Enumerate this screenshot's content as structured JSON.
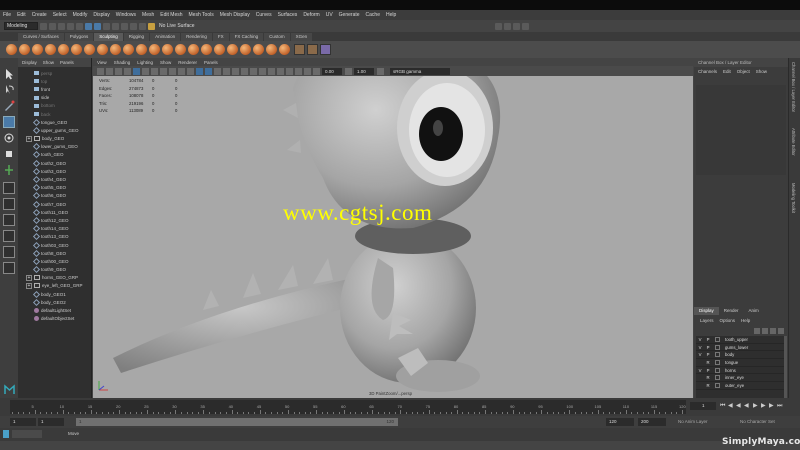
{
  "menubar": {
    "items": [
      "File",
      "Edit",
      "Create",
      "Select",
      "Modify",
      "Display",
      "Windows",
      "Mesh",
      "Edit Mesh",
      "Mesh Tools",
      "Mesh Display",
      "Curves",
      "Surfaces",
      "Deform",
      "UV",
      "Generate",
      "Cache",
      "Help"
    ]
  },
  "statusline": {
    "mode": "Modeling",
    "live_surface": "No Live Surface"
  },
  "shelf": {
    "tabs": [
      "Curves / Surfaces",
      "Polygons",
      "Sculpting",
      "Rigging",
      "Animation",
      "Rendering",
      "FX",
      "FX Caching",
      "Custom",
      "XGen"
    ],
    "active_tab": "Sculpting"
  },
  "outliner": {
    "menu": [
      "Display",
      "Show",
      "Panels"
    ],
    "items": [
      {
        "label": "persp",
        "icon": "camera-icon",
        "dim": true,
        "expand": false
      },
      {
        "label": "top",
        "icon": "camera-icon",
        "dim": true,
        "expand": false
      },
      {
        "label": "front",
        "icon": "camera-icon",
        "dim": false,
        "expand": false
      },
      {
        "label": "side",
        "icon": "camera-icon",
        "dim": false,
        "expand": false
      },
      {
        "label": "bottom",
        "icon": "camera-icon",
        "dim": true,
        "expand": false
      },
      {
        "label": "back",
        "icon": "camera-icon",
        "dim": true,
        "expand": false
      },
      {
        "label": "tongue_GEO",
        "icon": "mesh-icon",
        "dim": false,
        "expand": false
      },
      {
        "label": "upper_gums_GEO",
        "icon": "mesh-icon",
        "dim": false,
        "expand": false
      },
      {
        "label": "body_GEO",
        "icon": "group-icon",
        "dim": false,
        "expand": true
      },
      {
        "label": "lower_gums_GEO",
        "icon": "mesh-icon",
        "dim": false,
        "expand": false
      },
      {
        "label": "tooth_GEO",
        "icon": "mesh-icon",
        "dim": false,
        "expand": false
      },
      {
        "label": "tooth2_GEO",
        "icon": "mesh-icon",
        "dim": false,
        "expand": false
      },
      {
        "label": "tooth3_GEO",
        "icon": "mesh-icon",
        "dim": false,
        "expand": false
      },
      {
        "label": "tooth4_GEO",
        "icon": "mesh-icon",
        "dim": false,
        "expand": false
      },
      {
        "label": "tooth5_GEO",
        "icon": "mesh-icon",
        "dim": false,
        "expand": false
      },
      {
        "label": "tooth6_GEO",
        "icon": "mesh-icon",
        "dim": false,
        "expand": false
      },
      {
        "label": "tooth7_GEO",
        "icon": "mesh-icon",
        "dim": false,
        "expand": false
      },
      {
        "label": "tooth11_GEO",
        "icon": "mesh-icon",
        "dim": false,
        "expand": false
      },
      {
        "label": "tooth12_GEO",
        "icon": "mesh-icon",
        "dim": false,
        "expand": false
      },
      {
        "label": "tooth14_GEO",
        "icon": "mesh-icon",
        "dim": false,
        "expand": false
      },
      {
        "label": "tooth13_GEO",
        "icon": "mesh-icon",
        "dim": false,
        "expand": false
      },
      {
        "label": "tooth03_GEO",
        "icon": "mesh-icon",
        "dim": false,
        "expand": false
      },
      {
        "label": "tooth8_GEO",
        "icon": "mesh-icon",
        "dim": false,
        "expand": false
      },
      {
        "label": "tooth00_GEO",
        "icon": "mesh-icon",
        "dim": false,
        "expand": false
      },
      {
        "label": "tooth9_GEO",
        "icon": "mesh-icon",
        "dim": false,
        "expand": false
      },
      {
        "label": "horns_GEO_GRP",
        "icon": "group-icon",
        "dim": false,
        "expand": true
      },
      {
        "label": "eye_left_GEO_GRP",
        "icon": "group-icon",
        "dim": false,
        "expand": true
      },
      {
        "label": "body_GEO1",
        "icon": "mesh-icon",
        "dim": false,
        "expand": false
      },
      {
        "label": "body_GEO2",
        "icon": "mesh-icon",
        "dim": false,
        "expand": false
      },
      {
        "label": "defaultLightSet",
        "icon": "set-icon",
        "dim": false,
        "expand": false
      },
      {
        "label": "defaultObjectSet",
        "icon": "set-icon",
        "dim": false,
        "expand": false
      }
    ]
  },
  "viewport": {
    "menu": [
      "View",
      "Shading",
      "Lighting",
      "Show",
      "Renderer",
      "Panels"
    ],
    "exposure": "0.00",
    "gamma_value": "1.00",
    "color_space": "sRGB gamma",
    "camera_label": "3D PaintZoom/...persp",
    "hud": [
      {
        "label": "Verts:",
        "a": "104784",
        "b": "0",
        "c": "0"
      },
      {
        "label": "Edges:",
        "a": "274873",
        "b": "0",
        "c": "0"
      },
      {
        "label": "Faces:",
        "a": "108078",
        "b": "0",
        "c": "0"
      },
      {
        "label": "Tris:",
        "a": "219196",
        "b": "0",
        "c": "0"
      },
      {
        "label": "UVs:",
        "a": "113089",
        "b": "0",
        "c": "0"
      }
    ],
    "watermark": "www.cgtsj.com"
  },
  "right_strip": {
    "tabs": [
      "Channel Box / Layer Editor",
      "Attribute Editor",
      "Modeling Toolkit"
    ]
  },
  "channel_box": {
    "title": "Channel Box / Layer Editor",
    "menu": [
      "Channels",
      "Edit",
      "Object",
      "Show"
    ]
  },
  "layer_editor": {
    "tabs": [
      "Display",
      "Render",
      "Anim"
    ],
    "active_tab": "Display",
    "menu": [
      "Layers",
      "Options",
      "Help"
    ],
    "layers": [
      {
        "v": "V",
        "p": "P",
        "name": "tooth_upper"
      },
      {
        "v": "V",
        "p": "P",
        "name": "gums_lower"
      },
      {
        "v": "V",
        "p": "P",
        "name": "body"
      },
      {
        "v": "",
        "p": "R",
        "name": "tongue"
      },
      {
        "v": "V",
        "p": "P",
        "name": "horns"
      },
      {
        "v": "",
        "p": "R",
        "name": "inner_eye"
      },
      {
        "v": "",
        "p": "R",
        "name": "outer_eye"
      }
    ]
  },
  "timeline": {
    "ticks": [
      "5",
      "10",
      "15",
      "20",
      "25",
      "30",
      "35",
      "40",
      "45",
      "50",
      "55",
      "60",
      "65",
      "70",
      "75",
      "80",
      "85",
      "90",
      "95",
      "100",
      "105",
      "110",
      "115",
      "120"
    ],
    "current_frame": "1"
  },
  "range": {
    "start": "1",
    "start_inner": "1",
    "slider_left": "1",
    "slider_right": "120",
    "end_inner": "120",
    "end": "200",
    "anim_layer": "No Anim Layer",
    "char_set": "No Character Set"
  },
  "cmdline": {
    "label": "Move"
  },
  "brand": {
    "logo": "SimplyMaya.com"
  },
  "colors": {
    "accent": "#4a7aa8",
    "viewport_bg": "#a8a8a8",
    "watermark": "#ffff00"
  }
}
